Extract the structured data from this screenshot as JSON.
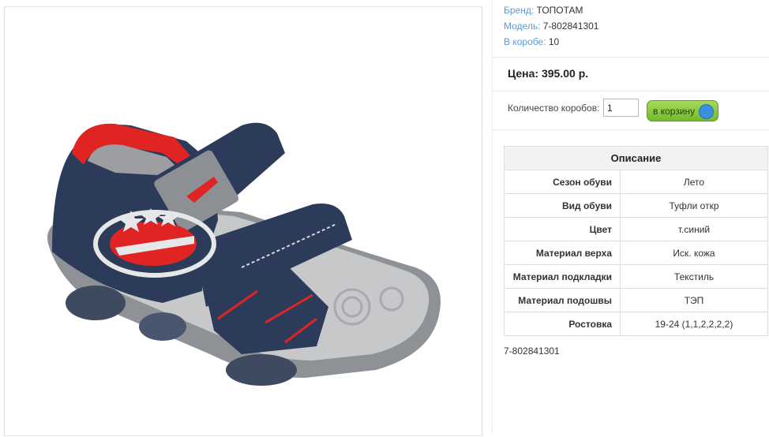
{
  "product": {
    "brand_label": "Бренд:",
    "brand": "ТОПОТАМ",
    "model_label": "Модель:",
    "model": "7-802841301",
    "box_label": "В коробе:",
    "box_qty": "10",
    "price": "Цена: 395.00 р.",
    "qty_label": "Количество коробов:",
    "qty_value": "1",
    "cart_button": "в корзину",
    "article": "7-802841301",
    "image_icon": "sandal-image"
  },
  "description": {
    "title": "Описание",
    "rows": [
      {
        "key": "Сезон обуви",
        "value": "Лето"
      },
      {
        "key": "Вид обуви",
        "value": "Туфли откр"
      },
      {
        "key": "Цвет",
        "value": "т.синий"
      },
      {
        "key": "Материал верха",
        "value": "Иск. кожа"
      },
      {
        "key": "Материал подкладки",
        "value": "Текстиль"
      },
      {
        "key": "Материал подошвы",
        "value": "ТЭП"
      },
      {
        "key": "Ростовка",
        "value": "19-24 (1,1,2,2,2,2)"
      }
    ]
  },
  "colors": {
    "accent_link": "#5b9bd5",
    "cart_green": "#7cc13a",
    "sandal_navy": "#2c3b5a",
    "sandal_red": "#e02424",
    "sole_grey": "#a7a9ac"
  }
}
